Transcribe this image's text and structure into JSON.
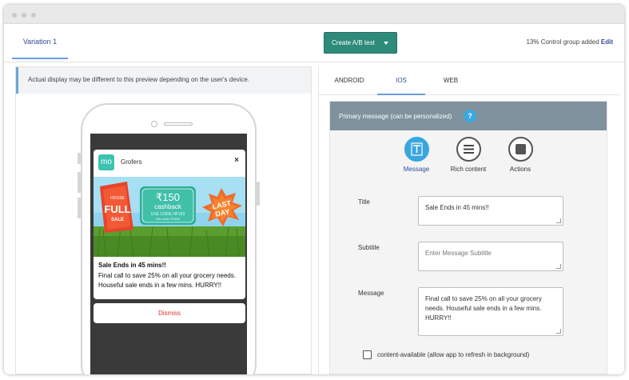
{
  "header": {
    "variation_tab": "Variation 1",
    "ab_button": "Create A/B test",
    "control_text": "13% Control group added",
    "control_edit": "Edit"
  },
  "preview": {
    "notice": "Actual display may be different to this preview depending on the user's device.",
    "notification": {
      "app_logo": "mo",
      "app_name": "Grofers",
      "close": "×",
      "banner": {
        "badge_top": "HOUSE",
        "badge_main": "FULL",
        "badge_bottom": "SALE",
        "cashback_amount": "₹150",
        "cashback_word": "cashback",
        "code_line": "USE CODE HF150",
        "min_line": "Min order ₹1999",
        "last": "LAST",
        "day": "DAY"
      },
      "title": "Sale Ends in 45 mins!!",
      "body": "Final call to save 25% on all your grocery needs. Houseful sale ends in a few mins. HURRY!!",
      "dismiss": "Dismiss"
    }
  },
  "editor": {
    "os_tabs": [
      "ANDROID",
      "IOS",
      "WEB"
    ],
    "active_os": "IOS",
    "primary_header": "Primary message (can be personalized)",
    "help": "?",
    "types": [
      {
        "label": "Message",
        "icon": "text-icon",
        "active": true
      },
      {
        "label": "Rich content",
        "icon": "list-icon",
        "active": false
      },
      {
        "label": "Actions",
        "icon": "square-icon",
        "active": false
      }
    ],
    "fields": {
      "title_label": "Title",
      "title_value": "Sale Ends in 45 mins!!",
      "subtitle_label": "Subtitle",
      "subtitle_placeholder": "Enter Message Subtitle",
      "message_label": "Message",
      "message_value": "Final call to save 25% on all your grocery needs. Houseful sale ends in a few mins. HURRY!!"
    },
    "content_available_label": "content-available (allow app to refresh in background)"
  },
  "colors": {
    "accent_blue": "#2f4e9a",
    "button_teal": "#2e8b7a",
    "header_slate": "#7f929d",
    "active_icon": "#3aa6e0",
    "dismiss_red": "#dd3333"
  }
}
